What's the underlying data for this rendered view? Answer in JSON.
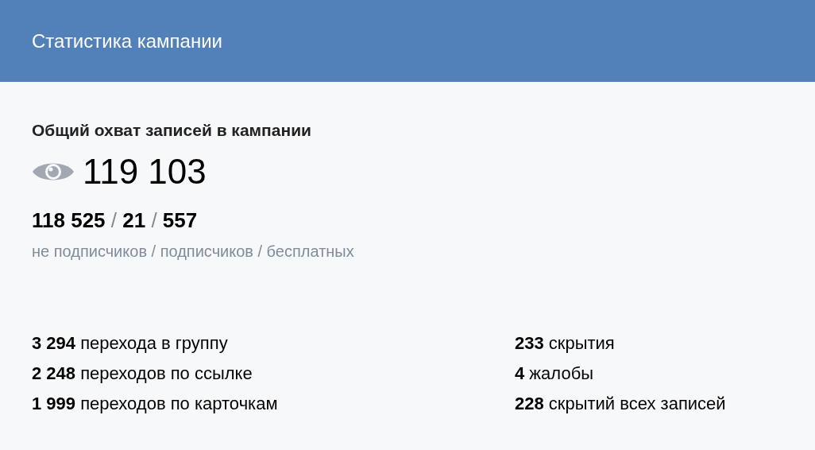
{
  "header": {
    "title": "Статистика кампании"
  },
  "reach": {
    "title": "Общий охват записей в кампании",
    "total": "119 103",
    "breakdown": "**118 525** / **21** / **557**",
    "breakdown_caption": "не подписчиков / подписчиков / бесплатных"
  },
  "stats_left": [
    "**3 294** перехода в группу",
    "**2 248** переходов по ссылке",
    "**1 999** переходов по карточкам"
  ],
  "stats_right": [
    "**233** скрытия",
    "**4** жалобы",
    "**228** скрытий всех записей"
  ]
}
